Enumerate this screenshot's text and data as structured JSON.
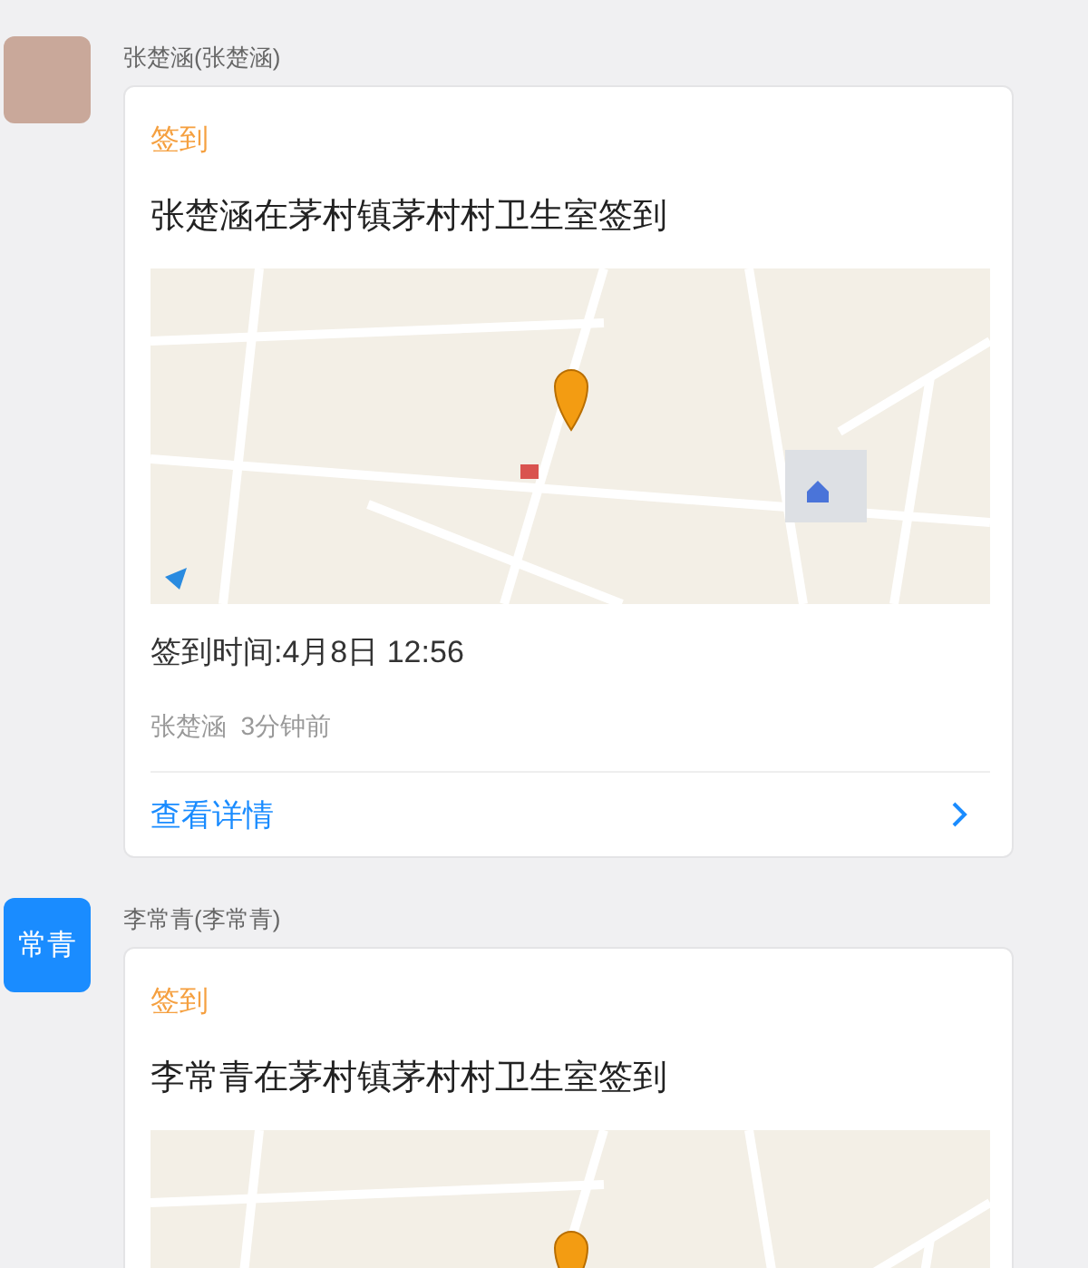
{
  "messages": [
    {
      "sender": "张楚涵(张楚涵)",
      "avatar": {
        "kind": "photo"
      },
      "card": {
        "type_label": "签到",
        "title": "张楚涵在茅村镇茅村村卫生室签到",
        "attachment": {
          "kind": "map"
        },
        "time": "签到时间:4月8日 12:56",
        "meta": "张楚涵  3分钟前",
        "link": "查看详情"
      }
    },
    {
      "sender": "李常青(李常青)",
      "avatar": {
        "kind": "text",
        "text": "常青"
      },
      "card": {
        "type_label": "签到",
        "title": "李常青在茅村镇茅村村卫生室签到",
        "attachment": {
          "kind": "map"
        }
      }
    }
  ]
}
